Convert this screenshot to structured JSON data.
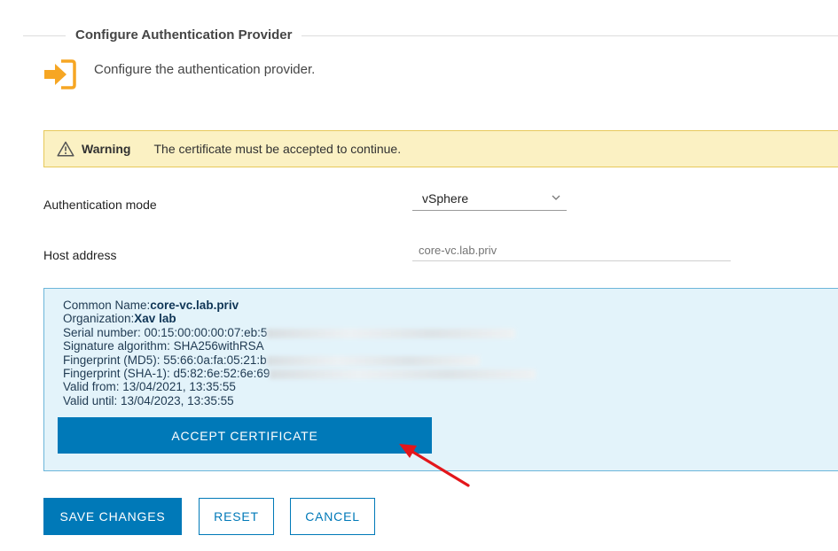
{
  "section": {
    "title": "Configure Authentication Provider"
  },
  "intro": {
    "icon": "sign-in-icon",
    "text": "Configure the authentication provider.",
    "icon_color": "#f6a623"
  },
  "warning": {
    "icon": "warning-triangle-icon",
    "label": "Warning",
    "message": "The certificate must be accepted to continue."
  },
  "form": {
    "auth_mode_label": "Authentication mode",
    "auth_mode_value": "vSphere",
    "host_label": "Host address",
    "host_placeholder": "core-vc.lab.priv"
  },
  "certificate": {
    "common_name_label": "Common Name:",
    "common_name_value": "core-vc.lab.priv",
    "organization_label": "Organization:",
    "organization_value": "Xav lab",
    "serial_number": "Serial number: 00:15:00:00:00:07:eb:5",
    "signature_algorithm": "Signature algorithm: SHA256withRSA",
    "fingerprint_md5": "Fingerprint (MD5): 55:66:0a:fa:05:21:b",
    "fingerprint_sha1": "Fingerprint (SHA-1): d5:82:6e:52:6e:69",
    "valid_from": "Valid from: 13/04/2021, 13:35:55",
    "valid_until": "Valid until: 13/04/2023, 13:35:55",
    "accept_label": "ACCEPT CERTIFICATE"
  },
  "actions": {
    "save_label": "SAVE CHANGES",
    "reset_label": "RESET",
    "cancel_label": "CANCEL"
  },
  "colors": {
    "primary": "#0079b8",
    "warning_bg": "#fbf1c3",
    "info_bg": "#e3f3fa",
    "annotation_arrow": "#e3161b"
  }
}
